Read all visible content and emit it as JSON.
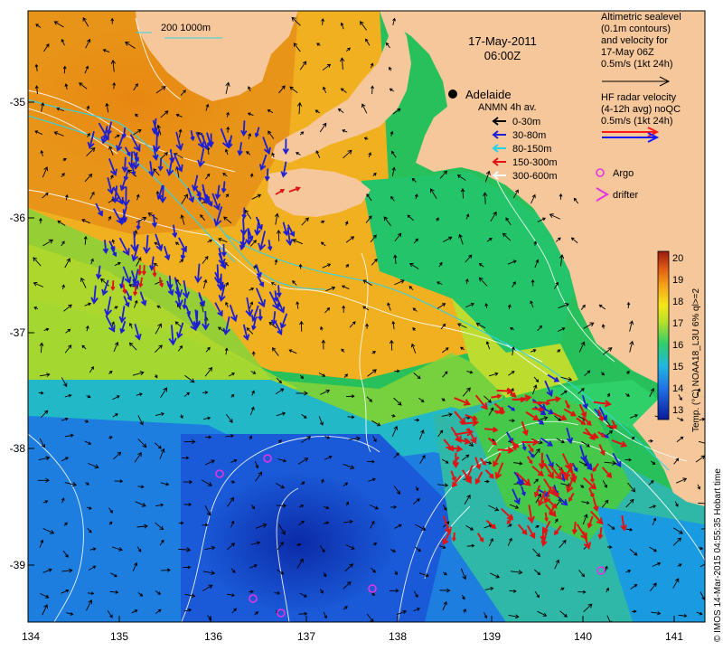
{
  "map": {
    "date_title": "17-May-2011",
    "time_title": "06:00Z",
    "city_label": "Adelaide",
    "scale_label": "200  1000m",
    "lat_ticks": [
      "-35",
      "-36",
      "-37",
      "-38",
      "-39"
    ],
    "lon_ticks": [
      "134",
      "135",
      "136",
      "137",
      "138",
      "139",
      "140",
      "141"
    ]
  },
  "legend": {
    "altimetry_lines": [
      "Altimetric sealevel",
      "(0.1m contours)",
      "and velocity for",
      "17-May 06Z",
      "0.5m/s (1kt 24h)"
    ],
    "hf_lines": [
      "HF radar velocity",
      "(4-12h avg) noQC",
      "0.5m/s (1kt 24h)"
    ],
    "anmn_title": "ANMN 4h av.",
    "anmn_items": [
      {
        "label": "0-30m",
        "color": "#000000"
      },
      {
        "label": "30-80m",
        "color": "#1e1ed2"
      },
      {
        "label": "80-150m",
        "color": "#22d3e6"
      },
      {
        "label": "150-300m",
        "color": "#e01414"
      },
      {
        "label": "300-600m",
        "color": "#ffffff"
      }
    ],
    "argo_label": "Argo",
    "drifter_label": "drifter"
  },
  "colorbar": {
    "ticks": [
      "20",
      "19",
      "18",
      "17",
      "16",
      "15",
      "14",
      "13"
    ],
    "label": "Temp. (°C) NOAA18_L3U 6% ql>=2"
  },
  "credit": "© IMOS 14-Mar-2015 04:55:35 Hobart time",
  "colors": {
    "land": "#f5c79a",
    "hf_red": "#ff1a1a",
    "hf_blue": "#1a1aff",
    "argo": "#e633e6"
  }
}
